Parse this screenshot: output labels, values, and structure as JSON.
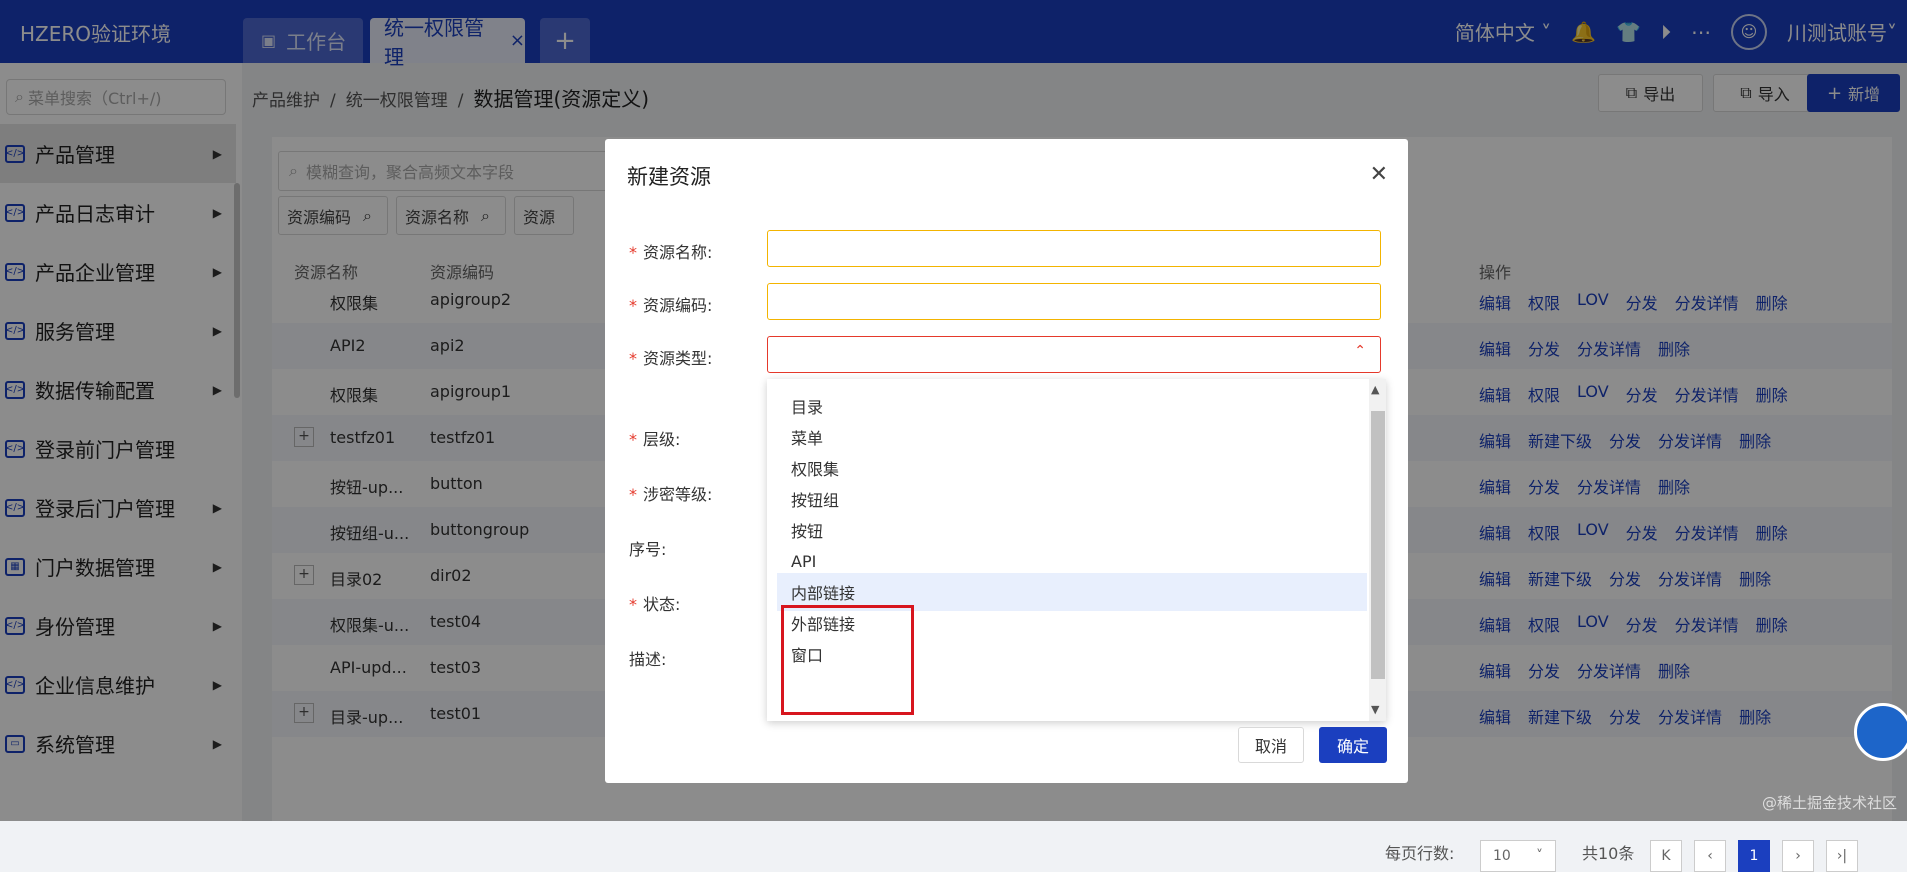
{
  "app": {
    "brand": "HZERO验证环境"
  },
  "tabs": [
    {
      "label": "工作台"
    },
    {
      "label": "统一权限管理",
      "close": "×"
    },
    {
      "label": "+"
    }
  ],
  "header_right": {
    "language": "简体中文",
    "account": "川测试账号"
  },
  "sidebar": {
    "search_placeholder": "菜单搜索（Ctrl+/)",
    "items": [
      {
        "label": "产品管理"
      },
      {
        "label": "产品日志审计"
      },
      {
        "label": "产品企业管理"
      },
      {
        "label": "服务管理"
      },
      {
        "label": "数据传输配置"
      },
      {
        "label": "登录前门户管理"
      },
      {
        "label": "登录后门户管理"
      },
      {
        "label": "门户数据管理"
      },
      {
        "label": "身份管理"
      },
      {
        "label": "企业信息维护"
      },
      {
        "label": "系统管理"
      }
    ]
  },
  "breadcrumb": {
    "items": [
      "产品维护",
      "统一权限管理"
    ],
    "current": "数据管理(资源定义)",
    "sep": "/"
  },
  "actions": {
    "export": "导出",
    "import": "导入",
    "new": "新增"
  },
  "filter": {
    "placeholder": "模糊查询，聚合高频文本字段",
    "chips": [
      "资源编码",
      "资源名称",
      "资源"
    ]
  },
  "table": {
    "headers": {
      "name": "资源名称",
      "code": "资源编码",
      "ops": "操作"
    },
    "rows": [
      {
        "name": "权限集",
        "code": "apigroup2",
        "ops": [
          "编辑",
          "权限",
          "LOV",
          "分发",
          "分发详情",
          "删除"
        ]
      },
      {
        "name": "API2",
        "code": "api2",
        "ops": [
          "编辑",
          "分发",
          "分发详情",
          "删除"
        ]
      },
      {
        "name": "权限集",
        "code": "apigroup1",
        "ops": [
          "编辑",
          "权限",
          "LOV",
          "分发",
          "分发详情",
          "删除"
        ]
      },
      {
        "name": "testfz01",
        "code": "testfz01",
        "expand": "+",
        "ops": [
          "编辑",
          "新建下级",
          "分发",
          "分发详情",
          "删除"
        ]
      },
      {
        "name": "按钮-up...",
        "code": "button",
        "ops": [
          "编辑",
          "分发",
          "分发详情",
          "删除"
        ]
      },
      {
        "name": "按钮组-u...",
        "code": "buttongroup",
        "ops": [
          "编辑",
          "权限",
          "LOV",
          "分发",
          "分发详情",
          "删除"
        ]
      },
      {
        "name": "目录02",
        "code": "dir02",
        "expand": "+",
        "ops": [
          "编辑",
          "新建下级",
          "分发",
          "分发详情",
          "删除"
        ]
      },
      {
        "name": "权限集-u...",
        "code": "test04",
        "ops": [
          "编辑",
          "权限",
          "LOV",
          "分发",
          "分发详情",
          "删除"
        ]
      },
      {
        "name": "API-upd...",
        "code": "test03",
        "ops": [
          "编辑",
          "分发",
          "分发详情",
          "删除"
        ]
      },
      {
        "name": "目录-up...",
        "code": "test01",
        "expand": "+",
        "ops": [
          "编辑",
          "新建下级",
          "分发",
          "分发详情",
          "删除"
        ]
      }
    ]
  },
  "pagination": {
    "page_size_label": "每页行数:",
    "page_size": "10",
    "total": "共10条",
    "current": "1"
  },
  "modal": {
    "title": "新建资源",
    "fields": {
      "name": "资源名称:",
      "code": "资源编码:",
      "type": "资源类型:",
      "level": "层级:",
      "secret": "涉密等级:",
      "order": "序号:",
      "status": "状态:",
      "desc": "描述:"
    },
    "required_mark": "*",
    "type_options": [
      "目录",
      "菜单",
      "权限集",
      "按钮组",
      "按钮",
      "API",
      "内部链接",
      "外部链接",
      "窗口"
    ],
    "hovered_option": "内部链接",
    "cancel": "取消",
    "ok": "确定"
  },
  "watermark": "@稀土掘金技术社区",
  "colors": {
    "primary": "#1b3fbf",
    "error": "#e5392b",
    "warning": "#f3b400",
    "highlight": "#d7151e"
  }
}
